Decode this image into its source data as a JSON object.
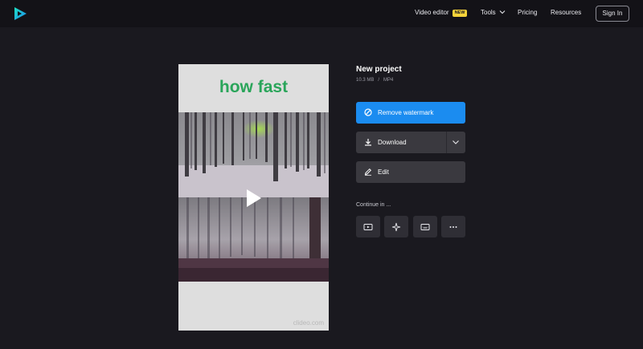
{
  "header": {
    "nav": {
      "video_editor": "Video editor",
      "new_badge": "NEW",
      "tools": "Tools",
      "pricing": "Pricing",
      "resources": "Resources"
    },
    "sign_in": "Sign In"
  },
  "preview": {
    "caption": "how fast",
    "watermark": "clideo.com"
  },
  "project": {
    "title": "New project",
    "size": "10.3 MB",
    "separator": "/",
    "format": "MP4"
  },
  "actions": {
    "remove_watermark": "Remove watermark",
    "download": "Download",
    "edit": "Edit"
  },
  "continue": {
    "label": "Continue in ..."
  },
  "colors": {
    "background": "#1a191f",
    "header": "#131217",
    "accent_blue": "#1b8cf0",
    "button_dark": "#3a393f",
    "caption_green": "#2aa55a",
    "badge_yellow": "#f5d33a"
  }
}
